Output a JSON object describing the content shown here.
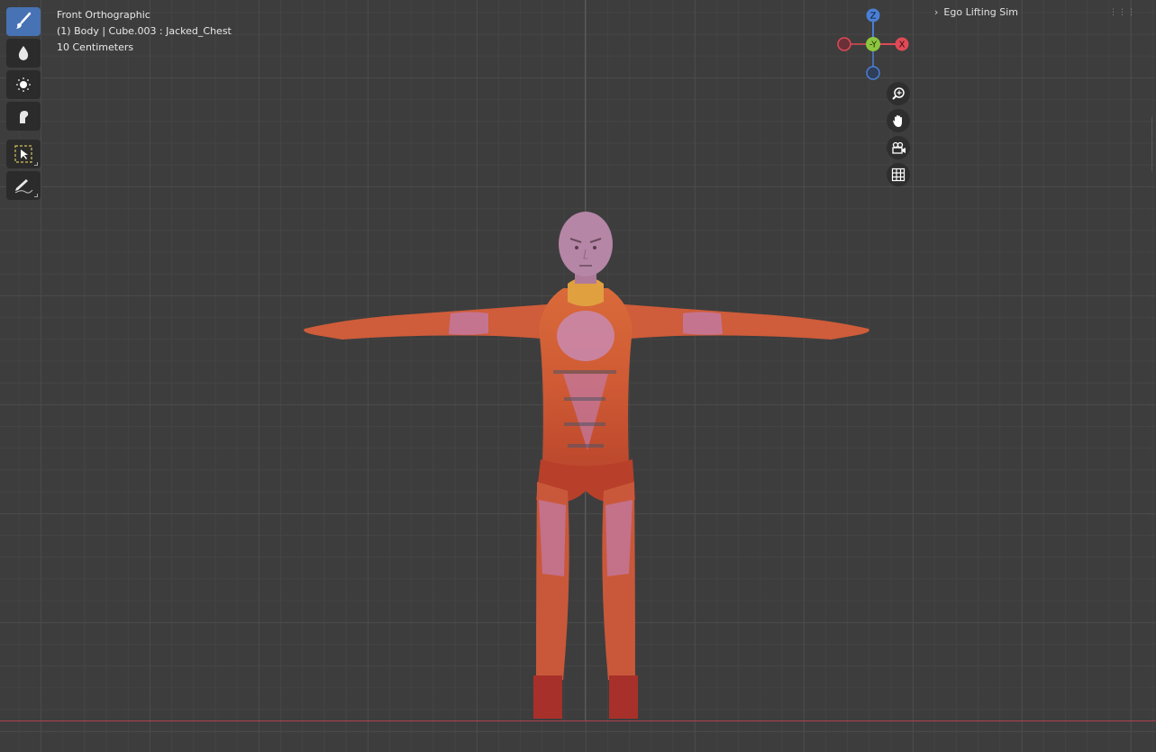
{
  "viewport": {
    "view_name": "Front Orthographic",
    "object_info": "(1) Body | Cube.003 : Jacked_Chest",
    "grid_scale": "10 Centimeters"
  },
  "scene_panel": {
    "chevron_icon": "chevron-right-icon",
    "title": "Ego Lifting Sim"
  },
  "gizmo": {
    "z_label": "Z",
    "y_label": "-Y",
    "x_label": "X",
    "colors": {
      "x": "#e04a56",
      "y": "#8cc63e",
      "z": "#4a7fd6"
    }
  },
  "toolbar": {
    "tools": [
      {
        "icon": "paint-brush-icon",
        "active": true
      },
      {
        "icon": "blur-drop-icon",
        "active": false
      },
      {
        "icon": "average-dots-icon",
        "active": false
      },
      {
        "icon": "smear-finger-icon",
        "active": false
      },
      {
        "icon": "select-box-icon",
        "active": false
      },
      {
        "icon": "annotate-pencil-icon",
        "active": false
      }
    ]
  },
  "nav_buttons": [
    "zoom-icon",
    "pan-hand-icon",
    "camera-icon",
    "grid-view-icon"
  ]
}
